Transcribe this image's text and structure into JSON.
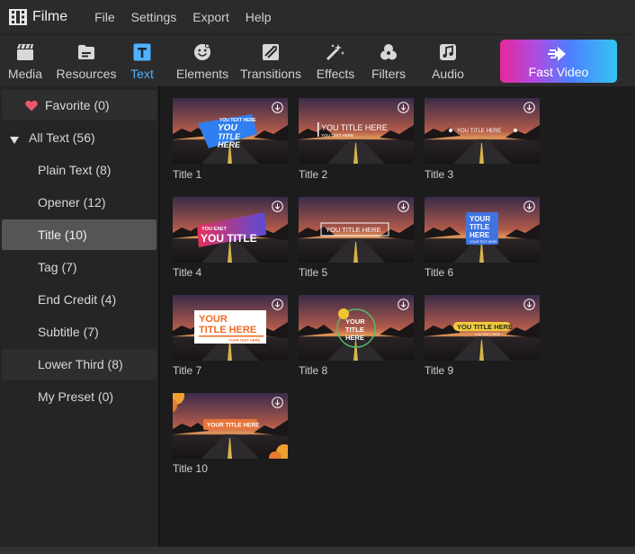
{
  "app": {
    "name": "Filme",
    "menu": [
      "File",
      "Settings",
      "Export",
      "Help"
    ]
  },
  "toolbar": {
    "tabs": [
      {
        "label": "Media",
        "icon": "clapperboard-icon"
      },
      {
        "label": "Resources",
        "icon": "folder-icon"
      },
      {
        "label": "Text",
        "icon": "text-icon",
        "active": true
      },
      {
        "label": "Elements",
        "icon": "smiley-icon"
      },
      {
        "label": "Transitions",
        "icon": "transition-icon"
      },
      {
        "label": "Effects",
        "icon": "sparkle-icon"
      },
      {
        "label": "Filters",
        "icon": "filters-icon"
      },
      {
        "label": "Audio",
        "icon": "music-icon"
      }
    ],
    "fast_video": "Fast Video",
    "accent": "#4fb2ff"
  },
  "sidebar": {
    "items": [
      {
        "label": "Favorite (0)"
      },
      {
        "label": "All Text (56)"
      },
      {
        "label": "Plain Text (8)"
      },
      {
        "label": "Opener (12)"
      },
      {
        "label": "Title (10)",
        "selected": true
      },
      {
        "label": "Tag (7)"
      },
      {
        "label": "End Credit (4)"
      },
      {
        "label": "Subtitle (7)"
      },
      {
        "label": "Lower Third (8)"
      },
      {
        "label": "My Preset (0)"
      }
    ]
  },
  "thumbnails": [
    {
      "label": "Title 1",
      "lines": [
        "YOU TEXT HERE",
        "YOU",
        "TITLE",
        "HERE"
      ]
    },
    {
      "label": "Title 2",
      "lines": [
        "YOU TITLE HERE",
        "YOU TEXT HERE"
      ]
    },
    {
      "label": "Title 3",
      "lines": [
        "YOU TITLE HERE"
      ]
    },
    {
      "label": "Title 4",
      "lines": [
        "YOU EXET",
        "YOU TITLE"
      ]
    },
    {
      "label": "Title 5",
      "lines": [
        "YOU TITLE HERE"
      ]
    },
    {
      "label": "Title 6",
      "lines": [
        "YOUR",
        "TITLE",
        "HERE",
        "YOUR TEXT HERE"
      ]
    },
    {
      "label": "Title 7",
      "lines": [
        "YOUR",
        "TITLE HERE",
        "YOUR TEXT HERE"
      ]
    },
    {
      "label": "Title 8",
      "lines": [
        "YOUR",
        "TITLE",
        "HERE"
      ]
    },
    {
      "label": "Title 9",
      "lines": [
        "YOU TITLE HERE",
        "YOU TEXT HERE"
      ]
    },
    {
      "label": "Title 10",
      "lines": [
        "YOUR TITLE HERE"
      ]
    }
  ]
}
